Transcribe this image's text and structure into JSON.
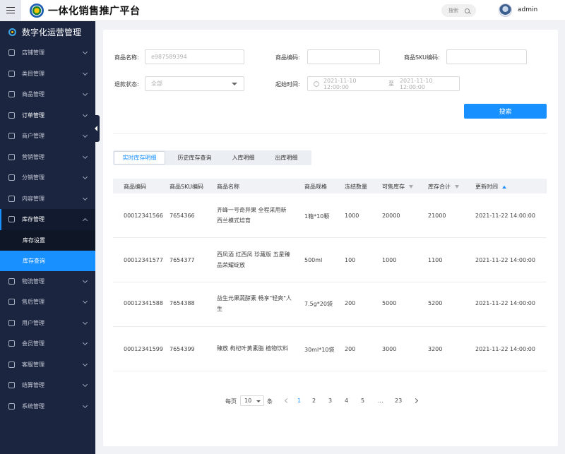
{
  "app": {
    "title": "一体化销售推广平台",
    "search_placeholder": "搜索",
    "user": "admin"
  },
  "sidebar": {
    "brand": "数字化运营管理",
    "items": [
      {
        "label": "店铺管理",
        "icon": "store-icon"
      },
      {
        "label": "类目管理",
        "icon": "box-icon"
      },
      {
        "label": "商品管理",
        "icon": "bag-icon"
      },
      {
        "label": "订单管理",
        "icon": "clipboard-icon"
      },
      {
        "label": "商户管理",
        "icon": "merchant-icon"
      },
      {
        "label": "营销管理",
        "icon": "chart-icon"
      },
      {
        "label": "分销管理",
        "icon": "network-icon"
      },
      {
        "label": "内容管理",
        "icon": "document-icon"
      },
      {
        "label": "库存管理",
        "icon": "inventory-icon"
      },
      {
        "label": "物流管理",
        "icon": "truck-icon"
      },
      {
        "label": "售后管理",
        "icon": "service-icon"
      },
      {
        "label": "用户管理",
        "icon": "users-icon"
      },
      {
        "label": "会员管理",
        "icon": "member-icon"
      },
      {
        "label": "客服管理",
        "icon": "headset-icon"
      },
      {
        "label": "结算管理",
        "icon": "settlement-icon"
      },
      {
        "label": "系统管理",
        "icon": "gear-icon"
      }
    ],
    "submenu": [
      "库存设置",
      "库存查询"
    ]
  },
  "filters": {
    "name_label": "商品名称:",
    "name_value": "e987589394",
    "code_label": "商品编码:",
    "sku_label": "商品SKU编码:",
    "refund_label": "退款状态:",
    "refund_value": "全部",
    "time_label": "起始时间:",
    "time_start": "2021-11-10 12:00:00",
    "time_sep": "至",
    "time_end": "2021-11-10 12:00:00",
    "search_button": "搜索"
  },
  "tabs": [
    "实时库存明细",
    "历史库存查询",
    "入库明细",
    "出库明细"
  ],
  "table": {
    "headers": [
      "商品编码",
      "商品SKU编码",
      "商品名称",
      "商品规格",
      "冻结数量",
      "可售库存",
      "库存合计",
      "更新时间"
    ],
    "rows": [
      [
        "00012341566",
        "7654366",
        "齐峰一号奇异果 全程采用新西兰模式培育",
        "1箱*10颗",
        "1000",
        "20000",
        "21000",
        "2021-11-22 14:00:00"
      ],
      [
        "00012341577",
        "7654377",
        "西凤酒 红西凤 珍藏版 五星臻品荣耀绽放",
        "500ml",
        "100",
        "1000",
        "1100",
        "2021-11-22 14:00:00"
      ],
      [
        "00012341588",
        "7654388",
        "益生元果蔬酵素 畅享\"轻爽\"人生",
        "7.5g*20袋",
        "200",
        "5000",
        "5200",
        "2021-11-22 14:00:00"
      ],
      [
        "00012341599",
        "7654399",
        "臻放 枸杞叶黄素脂 植物饮料",
        "30ml*10袋",
        "200",
        "3000",
        "3200",
        "2021-11-22 14:00:00"
      ]
    ]
  },
  "pagination": {
    "per_page_label": "每页",
    "per_page_value": "10",
    "unit_label": "条",
    "pages": [
      "1",
      "2",
      "3",
      "4",
      "5",
      "...",
      "23"
    ],
    "current": "1"
  }
}
